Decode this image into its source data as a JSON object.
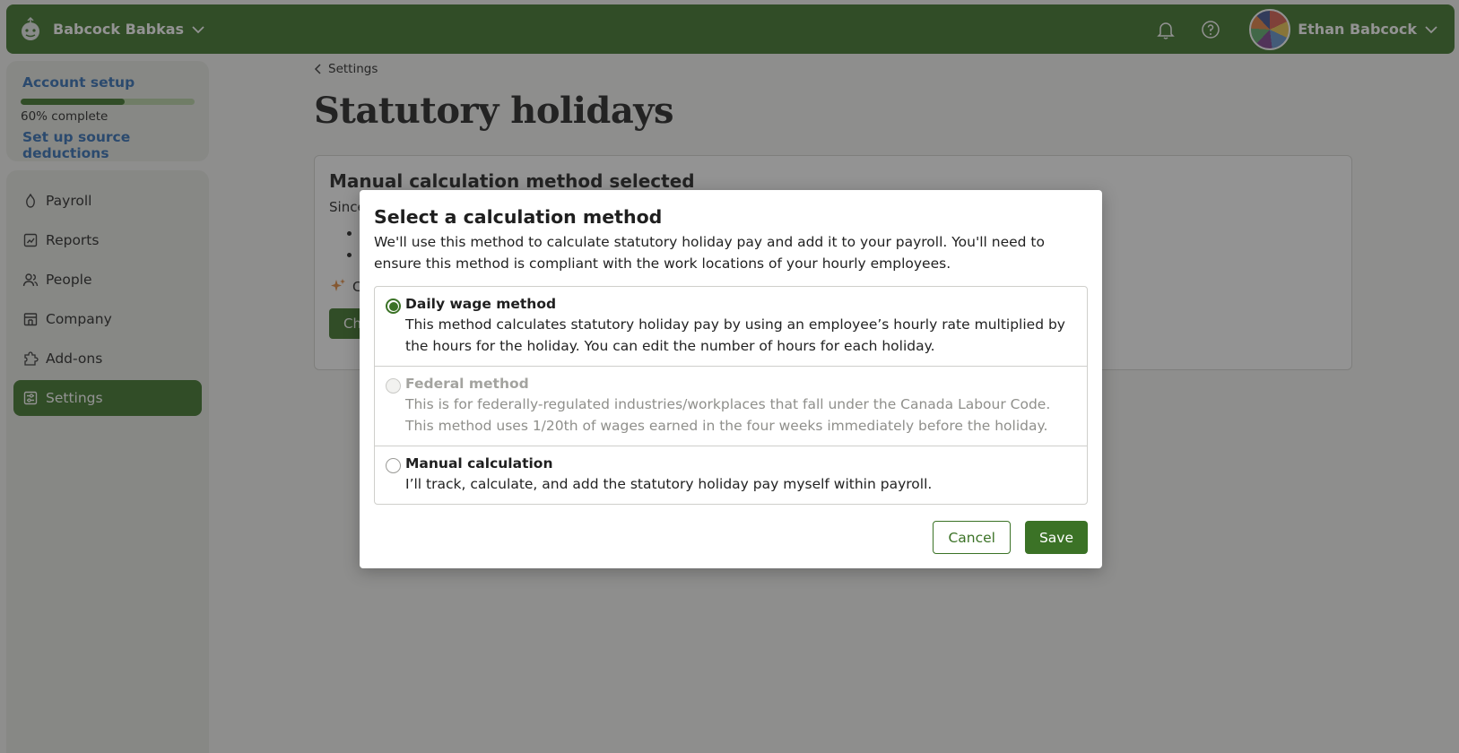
{
  "topbar": {
    "company_name": "Babcock Babkas",
    "user_name": "Ethan Babcock",
    "icons": [
      "bell-icon",
      "help-icon",
      "chevron-down-icon"
    ]
  },
  "setup": {
    "title": "Account setup",
    "progress_percent": 60,
    "progress_text": "60% complete",
    "next_step": "Set up source deductions"
  },
  "sidebar": {
    "items": [
      {
        "label": "Payroll",
        "icon": "payroll-icon",
        "active": false
      },
      {
        "label": "Reports",
        "icon": "reports-icon",
        "active": false
      },
      {
        "label": "People",
        "icon": "people-icon",
        "active": false
      },
      {
        "label": "Company",
        "icon": "company-icon",
        "active": false
      },
      {
        "label": "Add-ons",
        "icon": "puzzle-icon",
        "active": false
      },
      {
        "label": "Settings",
        "icon": "settings-icon",
        "active": true
      }
    ]
  },
  "main": {
    "breadcrumb": "Settings",
    "title": "Statutory holidays",
    "card": {
      "title": "Manual calculation method selected",
      "since_text": "Since",
      "hint_text": "C",
      "button_text": "Ch"
    }
  },
  "modal": {
    "title": "Select a calculation method",
    "description": "We'll use this method to calculate statutory holiday pay and add it to your payroll. You'll need to ensure this method is compliant with the work locations of your hourly employees.",
    "options": [
      {
        "title": "Daily wage method",
        "description": "This method calculates statutory holiday pay by using an employee’s hourly rate multiplied by the hours for the holiday. You can edit the number of hours for each holiday.",
        "selected": true,
        "disabled": false
      },
      {
        "title": "Federal method",
        "description": "This is for federally-regulated industries/workplaces that fall under the Canada Labour Code. This method uses 1/20th of wages earned in the four weeks immediately before the holiday.",
        "selected": false,
        "disabled": true
      },
      {
        "title": "Manual calculation",
        "description": "I’ll track, calculate, and add the statutory holiday pay myself within payroll.",
        "selected": false,
        "disabled": false
      }
    ],
    "cancel_label": "Cancel",
    "save_label": "Save"
  },
  "colors": {
    "brand": "#3b7226",
    "link": "#2f6cb5"
  }
}
